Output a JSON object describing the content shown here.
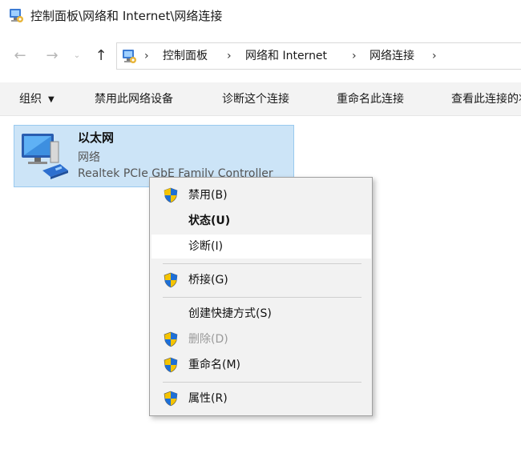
{
  "window": {
    "title": "控制面板\\网络和 Internet\\网络连接",
    "app_icon": "control-panel-icon"
  },
  "navigation": {
    "back_icon": "back-arrow-icon",
    "forward_icon": "forward-arrow-icon",
    "recent_icon": "chevron-down-icon",
    "up_icon": "up-arrow-icon",
    "breadcrumbs": [
      {
        "label": "控制面板"
      },
      {
        "label": "网络和 Internet"
      },
      {
        "label": "网络连接"
      }
    ],
    "separator": "›"
  },
  "command_bar": {
    "organize": "组织",
    "disable_device": "禁用此网络设备",
    "diagnose_connection": "诊断这个连接",
    "rename_connection": "重命名此连接",
    "view_status": "查看此连接的状态"
  },
  "connection": {
    "name": "以太网",
    "type": "网络",
    "device": "Realtek PCIe GbE Family Controller",
    "icon": "network-adapter-icon"
  },
  "context_menu": {
    "items": [
      {
        "label": "禁用(B)",
        "shield": true,
        "bold": false,
        "disabled": false
      },
      {
        "label": "状态(U)",
        "shield": false,
        "bold": true,
        "disabled": false
      },
      {
        "label": "诊断(I)",
        "shield": false,
        "bold": false,
        "disabled": false,
        "hover": true
      },
      {
        "label": "桥接(G)",
        "shield": true,
        "bold": false,
        "disabled": false
      },
      {
        "label": "创建快捷方式(S)",
        "shield": false,
        "bold": false,
        "disabled": false
      },
      {
        "label": "删除(D)",
        "shield": true,
        "bold": false,
        "disabled": true
      },
      {
        "label": "重命名(M)",
        "shield": true,
        "bold": false,
        "disabled": false
      },
      {
        "label": "属性(R)",
        "shield": true,
        "bold": false,
        "disabled": false
      }
    ]
  },
  "colors": {
    "selection_fill": "#cce4f7",
    "selection_border": "#99c9ef",
    "menu_background": "#f2f2f2",
    "disabled_text": "#9a9a9a"
  }
}
